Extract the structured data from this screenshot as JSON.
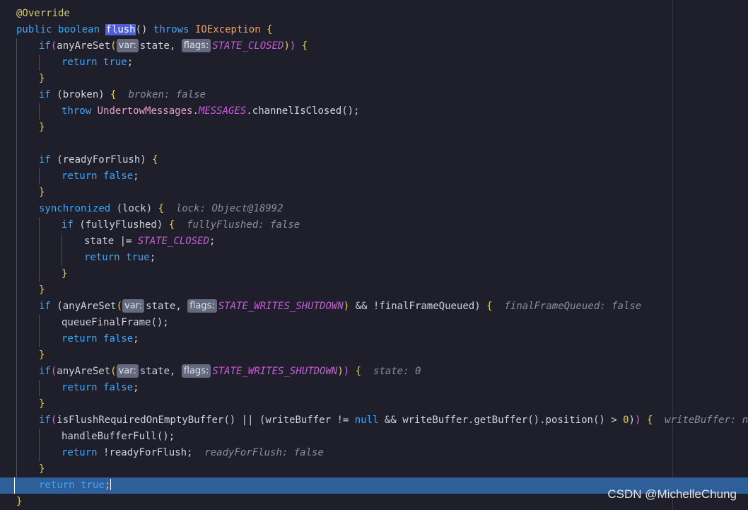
{
  "editor": {
    "language": "java",
    "method_keywords": [
      "public",
      "boolean",
      "throws"
    ],
    "annotation": "@Override",
    "method_name": "flush",
    "exception_type": "IOException",
    "hints": {
      "var": "var:",
      "flags": "flags:"
    },
    "identifiers": {
      "any_are_set": "anyAreSet",
      "state": "state",
      "state_closed": "STATE_CLOSED",
      "state_writes_shutdown": "STATE_WRITES_SHUTDOWN",
      "broken": "broken",
      "undertow_messages": "UndertowMessages",
      "messages": "MESSAGES",
      "channel_is_closed": "channelIsClosed",
      "ready_for_flush": "readyForFlush",
      "lock": "lock",
      "fully_flushed": "fullyFlushed",
      "final_frame_queued": "finalFrameQueued",
      "queue_final_frame": "queueFinalFrame",
      "is_flush_required": "isFlushRequiredOnEmptyBuffer",
      "write_buffer": "writeBuffer",
      "get_buffer": "getBuffer",
      "position": "position",
      "handle_buffer_full": "handleBufferFull"
    },
    "inline_values": {
      "broken": "broken: false",
      "lock": "lock: Object@18992",
      "fully_flushed": "fullyFlushed: false",
      "final_frame_queued": "finalFrameQueued: false",
      "state": "state: 0",
      "write_buffer": "writeBuffer: null",
      "ready_for_flush": "readyForFlush: false"
    },
    "literals": {
      "true": "true",
      "false": "false",
      "null": "null",
      "zero": "0"
    },
    "current_line": 30
  },
  "watermark": "CSDN @MichelleChung"
}
